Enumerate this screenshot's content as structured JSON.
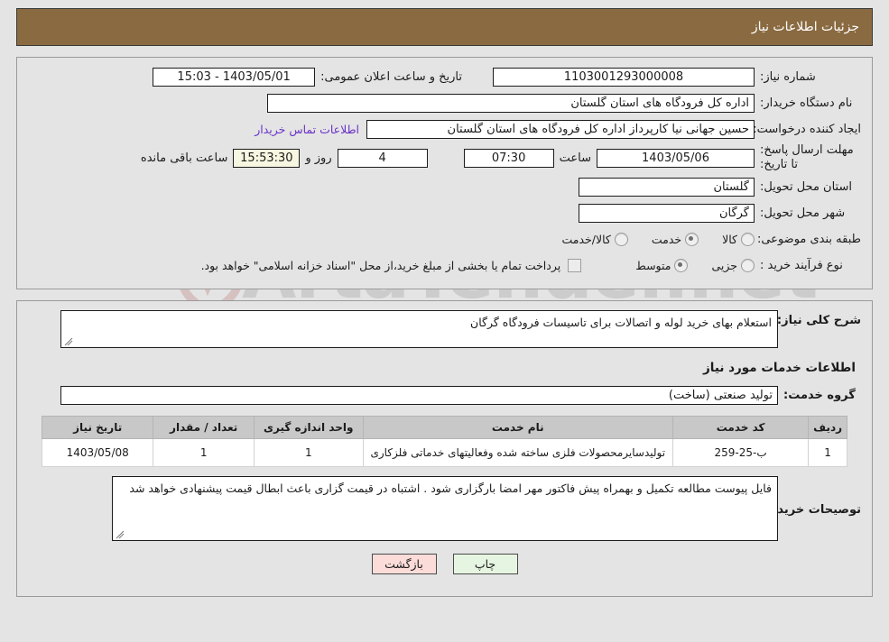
{
  "header": {
    "title": "جزئیات اطلاعات نیاز",
    "bg_color": "#8a6a41"
  },
  "watermark": {
    "text": "ArtaTender.net"
  },
  "top_form": {
    "need_number_label": "شماره نیاز:",
    "need_number_value": "1103001293000008",
    "announce_datetime_label": "تاریخ و ساعت اعلان عمومی:",
    "announce_datetime_value": "1403/05/01 - 15:03",
    "buyer_org_label": "نام دستگاه خریدار:",
    "buyer_org_value": "اداره کل فرودگاه های استان گلستان",
    "requester_label": "ایجاد کننده درخواست:",
    "requester_value": "حسین  جهانی نیا کارپرداز اداره کل فرودگاه های استان گلستان",
    "contact_link_label": "اطلاعات تماس خریدار",
    "deadline_label": "مهلت ارسال پاسخ: تا تاریخ:",
    "deadline_date_value": "1403/05/06",
    "deadline_hour_label": "ساعت",
    "deadline_hour_value": "07:30",
    "days_left_value": "4",
    "days_left_label": "روز و",
    "time_left_value": "15:53:30",
    "time_left_label": "ساعت باقی مانده",
    "province_label": "استان محل تحویل:",
    "province_value": "گلستان",
    "city_label": "شهر محل تحویل:",
    "city_value": "گرگان",
    "category_label": "طبقه بندی موضوعی:",
    "category_options": [
      {
        "label": "کالا",
        "selected": false
      },
      {
        "label": "خدمت",
        "selected": true
      },
      {
        "label": "کالا/خدمت",
        "selected": false
      }
    ],
    "process_label": "نوع فرآیند خرید :",
    "process_options": [
      {
        "label": "جزیی",
        "selected": false
      },
      {
        "label": "متوسط",
        "selected": true
      }
    ],
    "treasury_checkbox_checked": false,
    "treasury_checkbox_text": "پرداخت تمام یا بخشی از مبلغ خرید،از محل \"اسناد خزانه اسلامی\" خواهد بود."
  },
  "middle": {
    "general_desc_label": "شرح کلی نیاز:",
    "general_desc_value": "استعلام بهای خرید لوله و اتصالات برای تاسیسات فرودگاه گرگان",
    "section_heading": "اطلاعات خدمات مورد نیاز",
    "service_group_label": "گروه خدمت:",
    "service_group_value": "تولید صنعتی (ساخت)",
    "table": {
      "columns": [
        "ردیف",
        "کد خدمت",
        "نام خدمت",
        "واحد اندازه گیری",
        "تعداد / مقدار",
        "تاریخ نیاز"
      ],
      "rows": [
        {
          "radif": "1",
          "code": "ب-25-259",
          "name": "تولیدسایرمحصولات فلزی ساخته شده وفعالیتهای خدماتی فلزکاری",
          "unit": "1",
          "qty": "1",
          "date": "1403/05/08"
        }
      ]
    },
    "buyer_notes_label": "توصیحات خریدار:",
    "buyer_notes_value": "فایل پیوست مطالعه تکمیل و بهمراه پیش فاکتور مهر امضا بارگزاری شود . اشتباه در قیمت گزاری باعث ابطال قیمت پیشنهادی خواهد شد"
  },
  "footer": {
    "print_label": "چاپ",
    "back_label": "بازگشت"
  }
}
